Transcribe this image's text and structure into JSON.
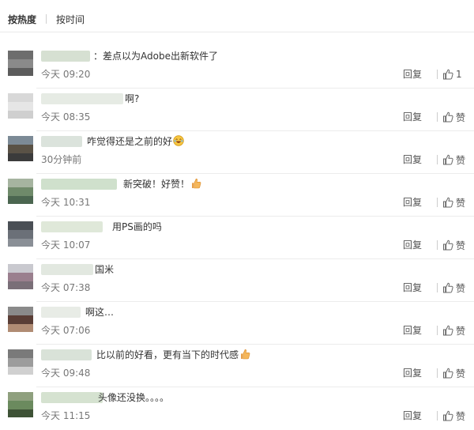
{
  "tabs": {
    "hot": "按热度",
    "time": "按时间"
  },
  "actions": {
    "reply": "回复",
    "like": "赞"
  },
  "comments": [
    {
      "text": "：差点以为Adobe出新软件了",
      "time": "今天 09:20",
      "likes": "1",
      "avatar": [
        "#6d6d6d",
        "#8a8a8a",
        "#5c5c5c"
      ]
    },
    {
      "text": "啊?",
      "time": "今天 08:35",
      "likes": "",
      "avatar": [
        "#d8d8d8",
        "#e6e6e6",
        "#cfcfcf"
      ]
    },
    {
      "text": "咋觉得还是之前的好",
      "time": "30分钟前",
      "likes": "",
      "avatar": [
        "#7c8a96",
        "#5a5246",
        "#3b3b3b"
      ]
    },
    {
      "text": "新突破！好赞！",
      "time": "今天 10:31",
      "likes": "",
      "avatar": [
        "#a6b4a0",
        "#6f8a6a",
        "#4b6650"
      ]
    },
    {
      "text": "用PS画的吗",
      "time": "今天 10:07",
      "likes": "",
      "avatar": [
        "#4a4f55",
        "#6b7078",
        "#8a8f96"
      ]
    },
    {
      "text": "国米",
      "time": "今天 07:38",
      "likes": "",
      "avatar": [
        "#c9c9cf",
        "#9a7f8e",
        "#7a6f78"
      ]
    },
    {
      "text": "啊这…",
      "time": "今天 07:06",
      "likes": "",
      "avatar": [
        "#8a8a8a",
        "#5a3e36",
        "#b08c74"
      ]
    },
    {
      "text": "比以前的好看，更有当下的时代感",
      "time": "今天 09:48",
      "likes": "",
      "avatar": [
        "#7a7a7a",
        "#9c9c9c",
        "#d0d0d0"
      ]
    },
    {
      "text": "头像还没换。。。。",
      "time": "今天 11:15",
      "likes": "",
      "avatar": [
        "#8fa07e",
        "#6b8a5e",
        "#3e5236"
      ]
    }
  ]
}
